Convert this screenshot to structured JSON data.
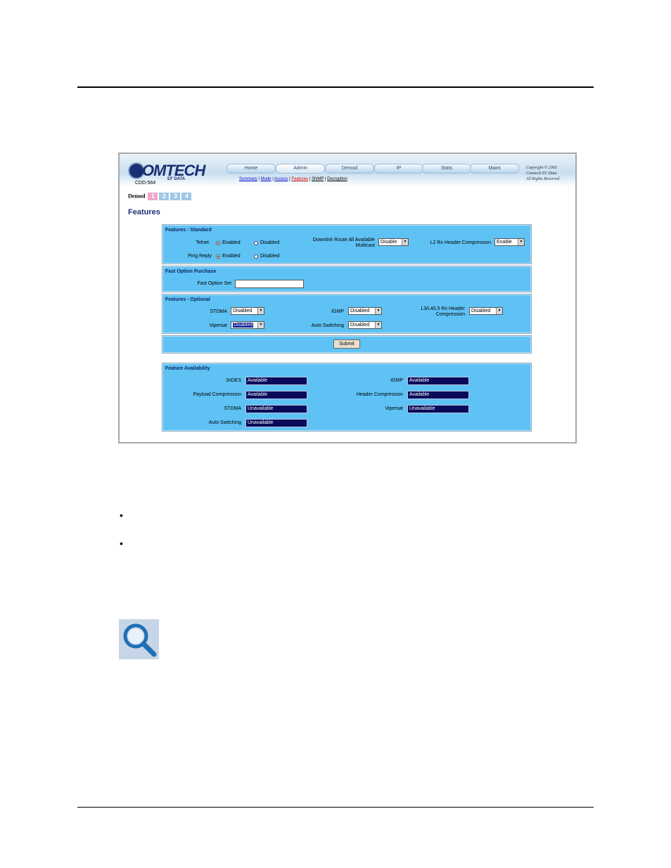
{
  "app": {
    "logo_text": "OMTECH",
    "logo_sub": "EF DATA",
    "model": "CDD-564",
    "tabs": [
      {
        "label": "Home"
      },
      {
        "label": "Admin"
      },
      {
        "label": "Demod"
      },
      {
        "label": "IP"
      },
      {
        "label": "Stats"
      },
      {
        "label": "Maint"
      }
    ],
    "subnav": [
      "Summary",
      "Mode",
      "Access",
      "Features",
      "SNMP",
      "Decryption"
    ],
    "subnav_sep": " | ",
    "copyright": [
      "Copyright © 2005",
      "Comtech EF Data",
      "All Rights Reserved"
    ],
    "demod_label": "Demod",
    "demod_nums": [
      "1",
      "2",
      "3",
      "4"
    ],
    "page_title": "Features"
  },
  "standard": {
    "header": "Features - Standard",
    "telnet_label": "Telnet",
    "ping_label": "Ping Reply",
    "enabled": "Enabled",
    "disabled": "Disabled",
    "downlink_label_1": "Downlink Route All Available",
    "downlink_label_2": "Multicast",
    "downlink_value": "Disable",
    "l2_label": "L2 Rx Header Compression",
    "l2_value": "Enable"
  },
  "fast_option": {
    "header": "Fast Option Purchase",
    "set_label": "Fast Option Set",
    "set_value": ""
  },
  "optional": {
    "header": "Features - Optional",
    "stdma_label": "STDMA",
    "stdma_value": "Disabled",
    "vipersat_label": "Vipersat",
    "vipersat_value": "Disabled",
    "igmp_label": "IGMP",
    "igmp_value": "Disabled",
    "autosw_label": "Auto Switching",
    "autosw_value": "Disabled",
    "l3_label_1": "L3/L4/L5 Rx Header",
    "l3_label_2": "Compression",
    "l3_value": "Disabled",
    "submit": "Submit"
  },
  "availability": {
    "header": "Feature Availability",
    "left": [
      {
        "label": "3xDES",
        "value": "Available"
      },
      {
        "label": "Payload Compression",
        "value": "Available"
      },
      {
        "label": "STDMA",
        "value": "Unavailable"
      },
      {
        "label": "Auto Switching",
        "value": "Unavailable"
      }
    ],
    "right": [
      {
        "label": "IGMP",
        "value": "Available"
      },
      {
        "label": "Header Compression",
        "value": "Available"
      },
      {
        "label": "Vipersat",
        "value": "Unavailable"
      }
    ]
  },
  "doc": {
    "bullet_glyph": "•"
  },
  "colors": {
    "panel": "#5ec2f5",
    "value_box": "#0a0a5a",
    "title": "#1a2f73",
    "note_icon": "#1f6fb5"
  },
  "icons": {
    "note": "magnifier-icon",
    "logo": "comtech-globe-icon"
  }
}
